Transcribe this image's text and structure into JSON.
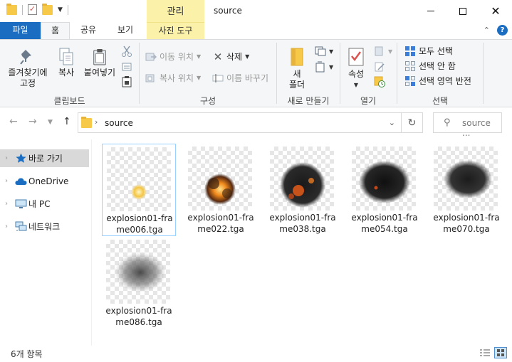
{
  "window": {
    "title": "source",
    "context_tab": "관리"
  },
  "tabs": {
    "file": "파일",
    "home": "홈",
    "share": "공유",
    "view": "보기",
    "picture_tools": "사진 도구"
  },
  "ribbon": {
    "clipboard": {
      "label": "클립보드",
      "pin_line1": "즐겨찾기에",
      "pin_line2": "고정",
      "copy": "복사",
      "paste": "붙여넣기"
    },
    "organize": {
      "label": "구성",
      "move_to": "이동 위치",
      "copy_to": "복사 위치",
      "delete": "삭제",
      "rename": "이름 바꾸기"
    },
    "new": {
      "label": "새로 만들기",
      "new_folder_line1": "새",
      "new_folder_line2": "폴더"
    },
    "open": {
      "label": "열기",
      "properties": "속성"
    },
    "select": {
      "label": "선택",
      "select_all": "모두 선택",
      "select_none": "선택 안 함",
      "invert": "선택 영역 반전"
    }
  },
  "address": {
    "path": "source",
    "search_placeholder": "source ..."
  },
  "nav": {
    "quick_access": "바로 가기",
    "onedrive": "OneDrive",
    "this_pc": "내 PC",
    "network": "네트워크"
  },
  "files": [
    {
      "name": "explosion01-frame006.tga"
    },
    {
      "name": "explosion01-frame022.tga"
    },
    {
      "name": "explosion01-frame038.tga"
    },
    {
      "name": "explosion01-frame054.tga"
    },
    {
      "name": "explosion01-frame070.tga"
    },
    {
      "name": "explosion01-frame086.tga"
    }
  ],
  "status": {
    "item_count": "6개 항목"
  },
  "colors": {
    "accent": "#1a6dc0",
    "context_tab": "#fbf1a9",
    "selection_border": "#99d1ff"
  }
}
